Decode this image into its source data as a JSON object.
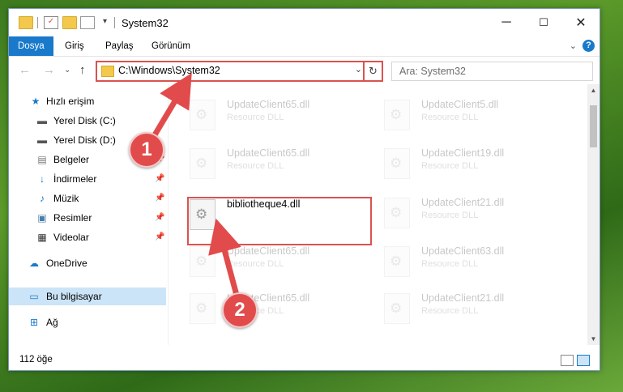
{
  "window": {
    "title": "System32"
  },
  "ribbon": {
    "tabs": [
      "Dosya",
      "Giriş",
      "Paylaş",
      "Görünüm"
    ],
    "help": "?"
  },
  "nav": {
    "address": "C:\\Windows\\System32",
    "search_placeholder": "Ara: System32"
  },
  "sidebar": {
    "items": [
      {
        "label": "Hızlı erişim",
        "icon": "star-icon"
      },
      {
        "label": "Yerel Disk (C:)",
        "icon": "drive-icon"
      },
      {
        "label": "Yerel Disk (D:)",
        "icon": "drive-icon"
      },
      {
        "label": "Belgeler",
        "icon": "documents-icon"
      },
      {
        "label": "İndirmeler",
        "icon": "download-icon"
      },
      {
        "label": "Müzik",
        "icon": "music-icon"
      },
      {
        "label": "Resimler",
        "icon": "pictures-icon"
      },
      {
        "label": "Videolar",
        "icon": "video-icon"
      },
      {
        "label": "OneDrive",
        "icon": "cloud-icon"
      },
      {
        "label": "Bu bilgisayar",
        "icon": "computer-icon"
      },
      {
        "label": "Ağ",
        "icon": "network-icon"
      }
    ]
  },
  "files": [
    {
      "name": "UpdateClient65.dll",
      "type": "Resource DLL"
    },
    {
      "name": "UpdateClient5.dll",
      "type": "Resource DLL"
    },
    {
      "name": "UpdateClient65.dll",
      "type": "Resource DLL"
    },
    {
      "name": "UpdateClient19.dll",
      "type": "Resource DLL"
    },
    {
      "name": "bibliotheque4.dll",
      "type": ""
    },
    {
      "name": "UpdateClient21.dll",
      "type": "Resource DLL"
    },
    {
      "name": "UpdateClient65.dll",
      "type": "Resource DLL"
    },
    {
      "name": "UpdateClient63.dll",
      "type": "Resource DLL"
    },
    {
      "name": "UpdateClient65.dll",
      "type": "Resource DLL"
    },
    {
      "name": "UpdateClient21.dll",
      "type": "Resource DLL"
    }
  ],
  "status": {
    "count": "112 öğe"
  },
  "annotations": {
    "step1": "1",
    "step2": "2"
  },
  "colors": {
    "accent": "#1979ca",
    "annotation": "#e24b4b"
  }
}
